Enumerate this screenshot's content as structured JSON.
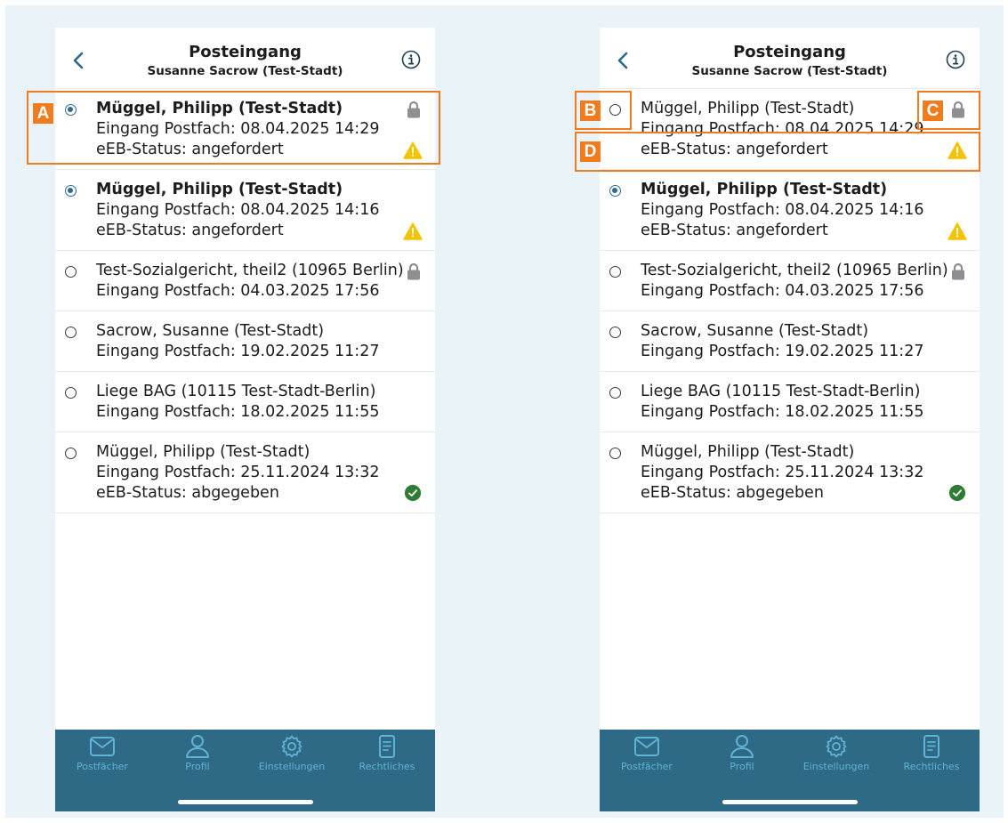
{
  "header": {
    "title": "Posteingang",
    "subtitle": "Susanne Sacrow (Test-Stadt)"
  },
  "messages": [
    {
      "sender": "Müggel, Philipp (Test-Stadt)",
      "received": "Eingang Postfach: 08.04.2025 14:29",
      "status": "eEB-Status: angefordert",
      "unread": true,
      "locked": true,
      "status_icon": "warning-icon"
    },
    {
      "sender": "Müggel, Philipp (Test-Stadt)",
      "received": "Eingang Postfach: 08.04.2025 14:16",
      "status": "eEB-Status: angefordert",
      "unread": true,
      "locked": false,
      "status_icon": "warning-icon"
    },
    {
      "sender": "Test-Sozialgericht, theil2 (10965 Berlin)",
      "received": "Eingang Postfach: 04.03.2025 17:56",
      "status": "",
      "unread": false,
      "locked": true,
      "status_icon": ""
    },
    {
      "sender": "Sacrow, Susanne (Test-Stadt)",
      "received": "Eingang Postfach: 19.02.2025 11:27",
      "status": "",
      "unread": false,
      "locked": false,
      "status_icon": ""
    },
    {
      "sender": "Liege BAG (10115 Test-Stadt-Berlin)",
      "received": "Eingang Postfach: 18.02.2025 11:55",
      "status": "",
      "unread": false,
      "locked": false,
      "status_icon": ""
    },
    {
      "sender": "Müggel, Philipp (Test-Stadt)",
      "received": "Eingang Postfach: 25.11.2024 13:32",
      "status": "eEB-Status: abgegeben",
      "unread": false,
      "locked": false,
      "status_icon": "check-circle-icon"
    }
  ],
  "tabbar": {
    "tabs": [
      {
        "label": "Postfächer",
        "icon": "envelope-icon"
      },
      {
        "label": "Profil",
        "icon": "person-icon"
      },
      {
        "label": "Einstellungen",
        "icon": "gear-icon"
      },
      {
        "label": "Rechtliches",
        "icon": "document-icon"
      }
    ]
  },
  "annotations": {
    "a": "A",
    "b": "B",
    "c": "C",
    "d": "D"
  },
  "colors": {
    "accent": "#2e6a86",
    "tab_label": "#5fb3d6",
    "callout": "#f07c1e",
    "warning": "#f5c400",
    "success": "#2e7d32",
    "lock": "#8e8e93"
  }
}
